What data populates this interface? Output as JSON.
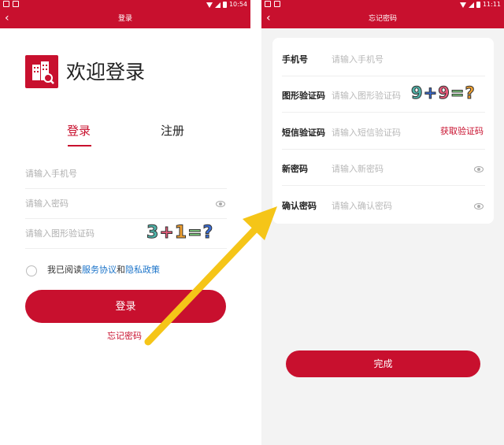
{
  "login_screen": {
    "status_time": "10:54",
    "title": "登录",
    "welcome": "欢迎登录",
    "tabs": {
      "login": "登录",
      "register": "注册"
    },
    "phone_placeholder": "请输入手机号",
    "password_placeholder": "请输入密码",
    "captcha_placeholder": "请输入图形验证码",
    "captcha_glyphs": [
      "3",
      "+",
      "1",
      "=",
      "?"
    ],
    "agreement": {
      "prefix": "我已阅读",
      "service": "服务协议",
      "and": "和",
      "privacy": "隐私政策"
    },
    "login_button": "登录",
    "forgot_link": "忘记密码"
  },
  "forgot_screen": {
    "status_time": "11:11",
    "title": "忘记密码",
    "rows": [
      {
        "label": "手机号",
        "placeholder": "请输入手机号"
      },
      {
        "label": "图形验证码",
        "placeholder": "请输入图形验证码"
      },
      {
        "label": "短信验证码",
        "placeholder": "请输入短信验证码"
      },
      {
        "label": "新密码",
        "placeholder": "请输入新密码"
      },
      {
        "label": "确认密码",
        "placeholder": "请输入确认密码"
      }
    ],
    "captcha_glyphs": [
      "9",
      "+",
      "9",
      "=",
      "?"
    ],
    "get_code": "获取验证码",
    "done_button": "完成"
  },
  "colors": {
    "brand_red": "#c8102e",
    "link_blue": "#1a73c9",
    "arrow_yellow": "#f5c518"
  }
}
